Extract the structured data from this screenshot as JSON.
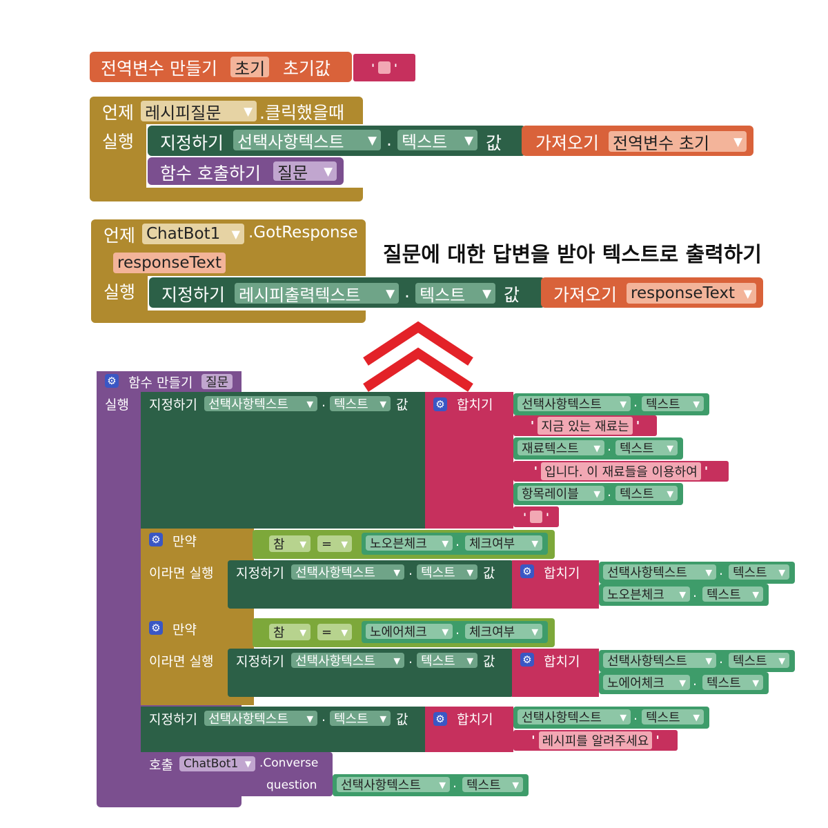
{
  "colors": {
    "variables": "#d9623a",
    "control": "#b08a2e",
    "component_set": "#2c6047",
    "procedure": "#7b4f8f",
    "text": "#c6305d",
    "property_get": "#3e9c6a",
    "logic": "#7da83a",
    "arrow": "#e32228"
  },
  "global_var": {
    "label": "전역변수 만들기",
    "name": "초기",
    "init_label": "초기값"
  },
  "event1": {
    "label": "언제",
    "component": "레시피질문",
    "event": ".클릭했을때",
    "do": "실행",
    "set_label": "지정하기",
    "set_component": "선택사항텍스트",
    "dot": ".",
    "set_prop": "텍스트",
    "to": "값",
    "get_label": "가져오기",
    "get_var": "전역변수 초기",
    "call_label": "함수 호출하기",
    "call_proc": "질문"
  },
  "event2": {
    "label": "언제",
    "component": "ChatBot1",
    "event": ".GotResponse",
    "param": "responseText",
    "do": "실행",
    "set_label": "지정하기",
    "set_component": "레시피출력텍스트",
    "dot": ".",
    "set_prop": "텍스트",
    "to": "값",
    "get_label": "가져오기",
    "get_var": "responseText"
  },
  "annotation": "질문에 대한 답변을 받아 텍스트로 출력하기",
  "procedure": {
    "label": "함수 만들기",
    "name": "질문",
    "do": "실행",
    "set_label": "지정하기",
    "set_component": "선택사항텍스트",
    "dot": ".",
    "set_prop": "텍스트",
    "to": "값",
    "join": "합치기",
    "join1": {
      "a_comp": "선택사항텍스트",
      "a_prop": "텍스트",
      "s1": "지금 있는 재료는",
      "b_comp": "재료텍스트",
      "b_prop": "텍스트",
      "s2": "입니다. 이 재료들을 이용하여",
      "c_comp": "항목레이블",
      "c_prop": "텍스트"
    },
    "if_label": "만약",
    "then_label": "이라면 실행",
    "if1": {
      "left": "참",
      "op": "=",
      "comp": "노오븐체크",
      "prop": "체크여부",
      "join_comp": "선택사항텍스트",
      "join_prop": "텍스트",
      "join_comp2": "노오븐체크",
      "join_prop2": "텍스트"
    },
    "if2": {
      "left": "참",
      "op": "=",
      "comp": "노에어체크",
      "prop": "체크여부",
      "join_comp": "선택사항텍스트",
      "join_prop": "텍스트",
      "join_comp2": "노에어체크",
      "join_prop2": "텍스트"
    },
    "join3": {
      "a_comp": "선택사항텍스트",
      "a_prop": "텍스트",
      "s1": "레시피를 알려주세요"
    },
    "call": {
      "label": "호출",
      "component": "ChatBot1",
      "method": ".Converse",
      "arg": "question",
      "arg_comp": "선택사항텍스트",
      "arg_prop": "텍스트"
    }
  }
}
